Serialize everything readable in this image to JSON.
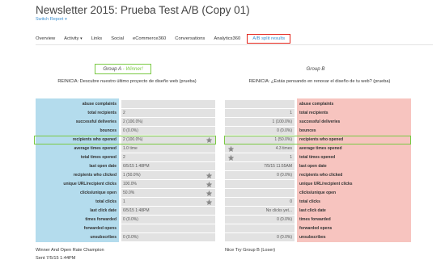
{
  "page_title": "Newsletter 2015: Prueba Test A/B (Copy 01)",
  "switch_report": "Switch Report",
  "nav": [
    "Overview",
    "Activity",
    "Links",
    "Social",
    "eCommerce360",
    "Conversations",
    "Analytics360",
    "A/B split results"
  ],
  "groupA": {
    "heading": "Group A",
    "winner": " - Winner!",
    "subject": "REINICIA: Descubre nuestro último proyecto de diseño web (prueba)",
    "values": [
      "",
      "2",
      "2 (100.0%)",
      "0 (0.0%)",
      "2 (100.0%)",
      "1.0 time",
      "2",
      "6/5/15 1:48PM",
      "1 (50.0%)",
      "100.0%",
      "50.0%",
      "1",
      "6/5/15 1:48PM",
      "0 (0.0%)",
      "",
      "0 (0.0%)"
    ],
    "footer_line1": "Winner And Open Rate Champion",
    "footer_line2": "Sent 7/5/15 1:44PM"
  },
  "groupB": {
    "heading": "Group B",
    "subject": "REINICIA: ¿Estás pensando en renovar el diseño de tu web? (prueba)",
    "values": [
      "",
      "1",
      "1 (100.0%)",
      "0 (0.0%)",
      "1 (50.0%)",
      "4.3 times",
      "1",
      "7/5/15 11:55AM",
      "0 (0.0%)",
      "",
      "",
      "0",
      "No clicks yet...",
      "0 (0.0%)",
      "",
      "0 (0.0%)"
    ],
    "footer": "Nice Try Group B (Loser)"
  },
  "metrics": [
    "abuse complaints",
    "total recipients",
    "successful deliveries",
    "bounces",
    "recipients who opened",
    "average times opened",
    "total times opened",
    "last open date",
    "recipients who clicked",
    "unique URL/recipient clicks",
    "clicks/unique open",
    "total clicks",
    "last click date",
    "times forwarded",
    "forwarded opens",
    "unsubscribes"
  ],
  "metricsB": [
    "abuse complaints",
    "total recipients",
    "successful deliveries",
    "bounces",
    "recipients who opened",
    "average times opened",
    "total times opened",
    "last open date",
    "recipients who clicked",
    "unique URL/recipient clicks",
    "clicks/unique open",
    "total clicks",
    "last click date",
    "times forwarded",
    "forwarded opens",
    "unsubscribes"
  ],
  "stars": {
    "a": [
      4,
      8,
      9,
      10,
      11
    ],
    "b": [
      5,
      6
    ]
  },
  "colors": {
    "groupA_bg": "#b4dced",
    "groupB_bg": "#f7c4bf",
    "winner": "#7ac943",
    "link": "#3b8fd0",
    "active_tab_border": "#e2231a"
  },
  "icons": {
    "star": "star-icon",
    "caret": "chevron-down-icon"
  }
}
